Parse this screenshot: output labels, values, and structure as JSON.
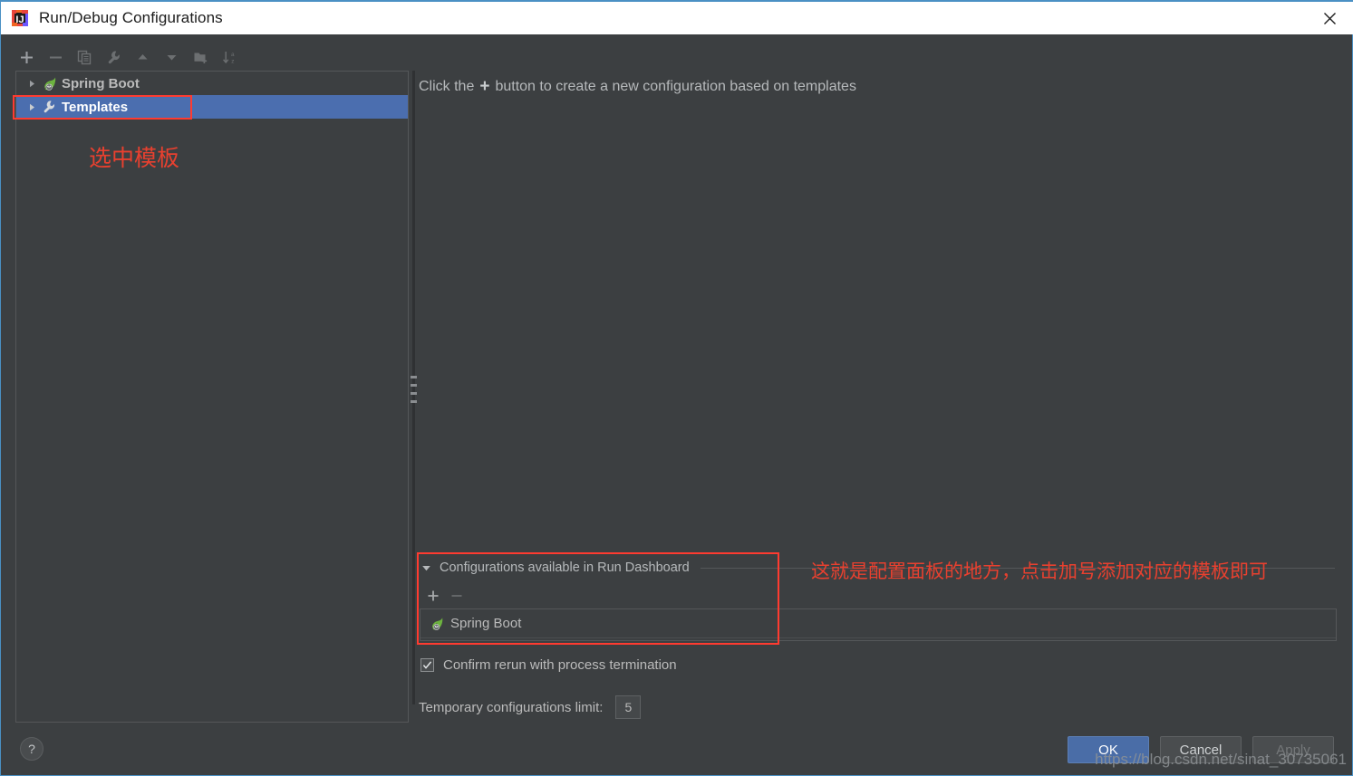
{
  "window": {
    "title": "Run/Debug Configurations",
    "app_icon": "intellij-idea-icon",
    "close_icon": "close-icon"
  },
  "toolbar": {
    "buttons": [
      {
        "name": "add-configuration-button",
        "icon": "plus-icon",
        "label": "+",
        "enabled": true
      },
      {
        "name": "remove-configuration-button",
        "icon": "minus-icon",
        "label": "−",
        "enabled": false
      },
      {
        "name": "copy-configuration-button",
        "icon": "copy-icon",
        "label": "Copy",
        "enabled": false
      },
      {
        "name": "edit-templates-button",
        "icon": "wrench-icon",
        "label": "Edit Templates",
        "enabled": false
      },
      {
        "name": "move-up-button",
        "icon": "arrow-up-icon",
        "label": "Move Up",
        "enabled": false
      },
      {
        "name": "move-down-button",
        "icon": "arrow-down-icon",
        "label": "Move Down",
        "enabled": false
      },
      {
        "name": "new-folder-button",
        "icon": "folder-add-icon",
        "label": "New Folder",
        "enabled": false
      },
      {
        "name": "sort-configurations-button",
        "icon": "sort-az-icon",
        "label": "Sort",
        "enabled": false
      }
    ]
  },
  "tree": {
    "items": [
      {
        "label": "Spring Boot",
        "icon": "spring-boot-icon",
        "expanded": false,
        "selected": false
      },
      {
        "label": "Templates",
        "icon": "wrench-icon",
        "expanded": false,
        "selected": true
      }
    ]
  },
  "right_panel": {
    "hint_prefix": "Click the",
    "hint_plus": "+",
    "hint_suffix": "button to create a new configuration based on templates"
  },
  "dashboard_section": {
    "collapse_icon": "triangle-down-icon",
    "title": "Configurations available in Run Dashboard",
    "mini_toolbar": [
      {
        "name": "dashboard-add-button",
        "icon": "plus-icon",
        "label": "+",
        "enabled": true
      },
      {
        "name": "dashboard-remove-button",
        "icon": "minus-icon",
        "label": "−",
        "enabled": false
      }
    ],
    "entries": [
      {
        "label": "Spring Boot",
        "icon": "spring-boot-icon"
      }
    ]
  },
  "options": {
    "confirm_rerun_label": "Confirm rerun with process termination",
    "confirm_rerun_checked": true,
    "check_glyph": "✓",
    "temp_limit_label": "Temporary configurations limit:",
    "temp_limit_value": "5"
  },
  "footer": {
    "help_label": "?",
    "ok_label": "OK",
    "cancel_label": "Cancel",
    "apply_label": "Apply",
    "apply_enabled": false,
    "watermark": "https://blog.csdn.net/sinat_30735061"
  },
  "annotations": {
    "templates_note": "选中模板",
    "dashboard_note": "这就是配置面板的地方，点击加号添加对应的模板即可"
  },
  "colors": {
    "background": "#3c3f41",
    "selection": "#4b6eaf",
    "accent_primary": "#4a6da7",
    "annotation_red": "#ff3b30",
    "border": "#555759",
    "text": "#bbbbbb"
  }
}
